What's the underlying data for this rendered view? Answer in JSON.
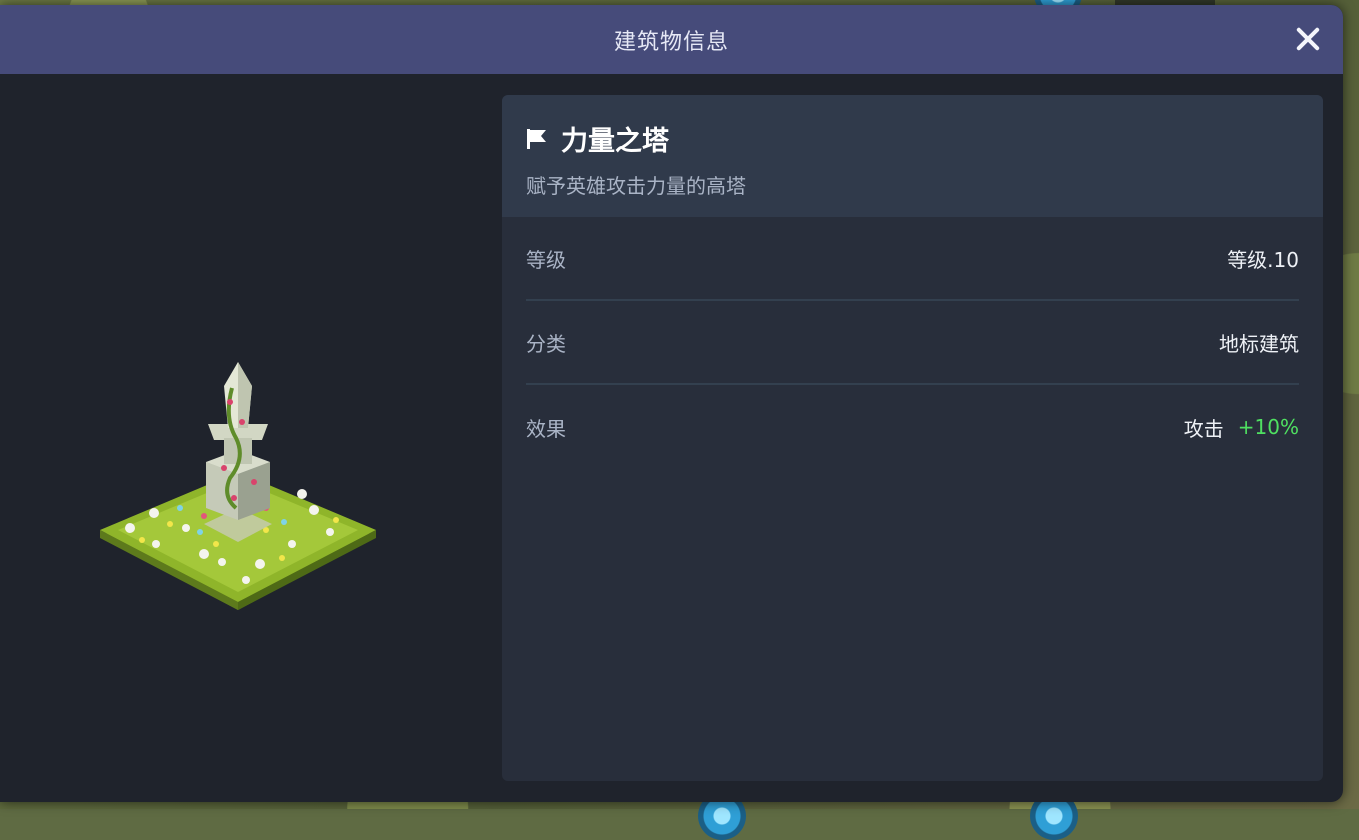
{
  "dialog": {
    "title": "建筑物信息"
  },
  "building": {
    "name": "力量之塔",
    "description": "赋予英雄攻击力量的高塔",
    "stats": [
      {
        "label": "等级",
        "value": "等级.10"
      },
      {
        "label": "分类",
        "value": "地标建筑"
      },
      {
        "label": "效果",
        "value": "攻击",
        "bonus": "+10%"
      }
    ]
  },
  "icons": {
    "close": "close-icon",
    "flag": "flag-icon",
    "building_sprite": "tower-of-power-sprite"
  },
  "colors": {
    "title_bar": "#464b7a",
    "dialog_bg": "#1f232c",
    "panel_bg": "#282e3b",
    "panel_header": "#303a4b",
    "bonus_green": "#4fe061"
  }
}
